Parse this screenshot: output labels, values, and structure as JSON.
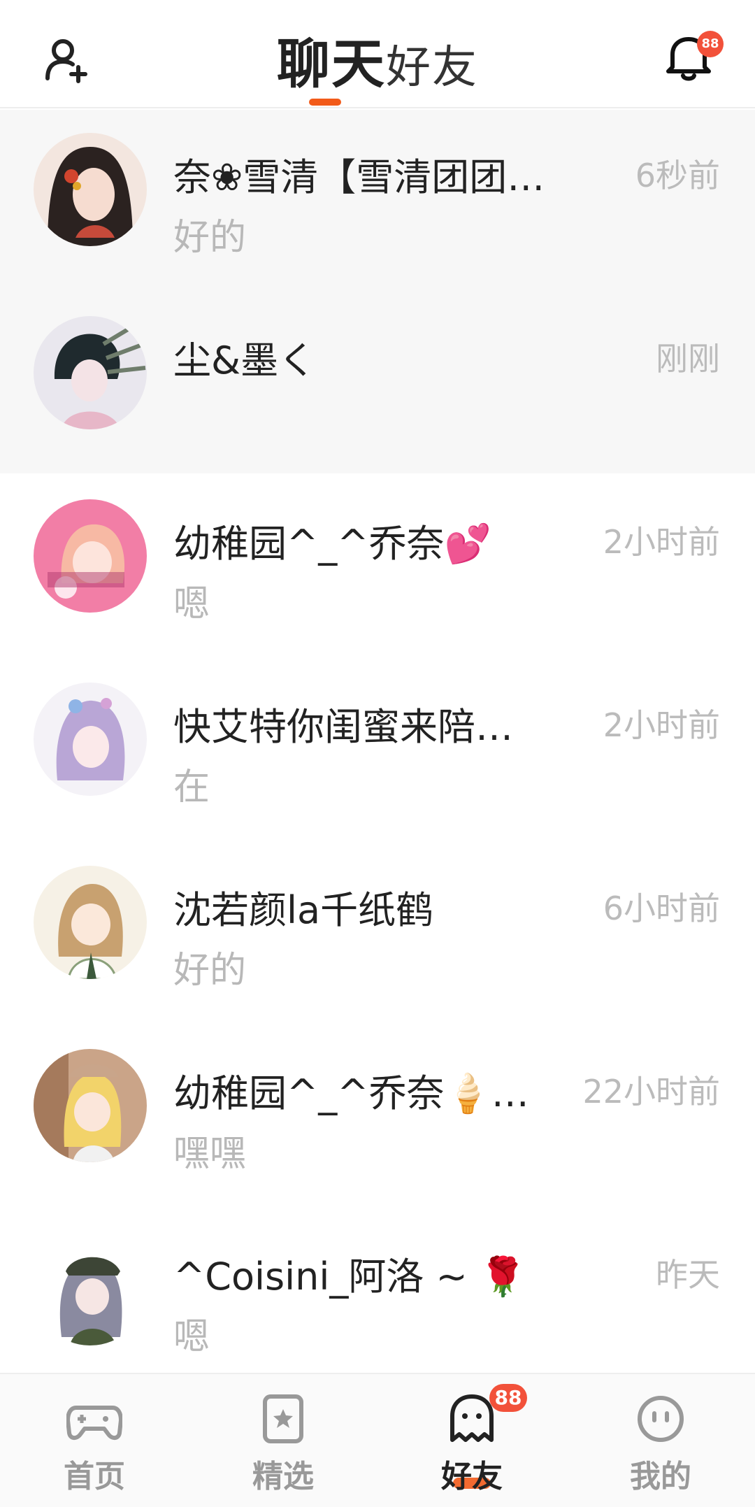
{
  "header": {
    "tab_chat": "聊天",
    "tab_friends": "好友",
    "notification_count": "88",
    "accent_color": "#f25a19"
  },
  "chats": [
    {
      "name": "奈❀雪清【雪清团团…",
      "time": "6秒前",
      "message": "好的"
    },
    {
      "name": "尘&墨く",
      "time": "刚刚",
      "message": ""
    },
    {
      "name": "幼稚园^_^乔奈💕",
      "time": "2小时前",
      "message": "嗯"
    },
    {
      "name": "快艾特你闺蜜来陪…",
      "time": "2小时前",
      "message": "在"
    },
    {
      "name": "沈若颜la千纸鹤",
      "time": "6小时前",
      "message": "好的"
    },
    {
      "name": "幼稚园^_^乔奈🍦…",
      "time": "22小时前",
      "message": "嘿嘿"
    },
    {
      "name": "^Coisini_阿洛 ~ 🌹",
      "time": "昨天",
      "message": "嗯"
    }
  ],
  "bottom_nav": {
    "home": "首页",
    "featured": "精选",
    "friends": "好友",
    "mine": "我的",
    "friends_badge": "88"
  }
}
